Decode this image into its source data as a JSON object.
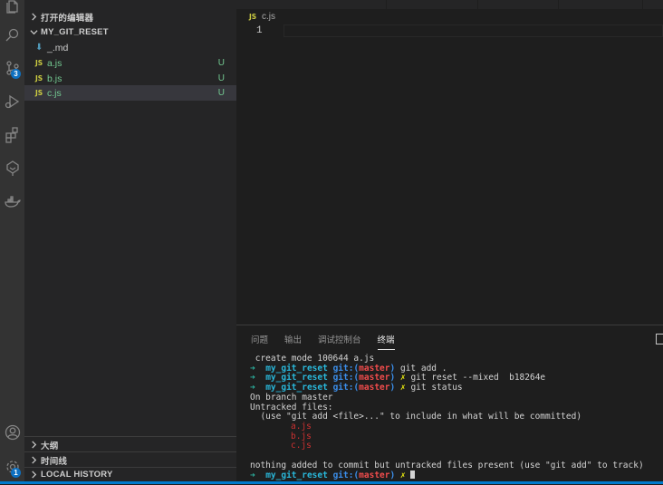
{
  "activity_bar": {
    "items": [
      {
        "icon": "files-icon"
      },
      {
        "icon": "search-icon"
      },
      {
        "icon": "source-control-icon",
        "badge": "3"
      },
      {
        "icon": "run-debug-icon"
      },
      {
        "icon": "extensions-icon"
      },
      {
        "icon": "tree-icon"
      },
      {
        "icon": "docker-icon"
      }
    ],
    "bottom": [
      {
        "icon": "account-icon"
      },
      {
        "icon": "settings-gear-icon",
        "badge": "1"
      }
    ]
  },
  "sidebar": {
    "open_editors_title": "打开的编辑器",
    "folder_title": "MY_GIT_RESET",
    "files": [
      {
        "name": "_.md",
        "icon": "markdown-icon",
        "status": ""
      },
      {
        "name": "a.js",
        "icon": "js-icon",
        "status": "U"
      },
      {
        "name": "b.js",
        "icon": "js-icon",
        "status": "U"
      },
      {
        "name": "c.js",
        "icon": "js-icon",
        "status": "U"
      }
    ],
    "outline_title": "大纲",
    "timeline_title": "时间线",
    "local_history_title": "LOCAL HISTORY"
  },
  "editor": {
    "breadcrumb_icon": "JS",
    "breadcrumb_file": "c.js",
    "line_number": "1"
  },
  "panel": {
    "tabs": [
      "问题",
      "输出",
      "调试控制台",
      "终端"
    ],
    "active_tab": "终端"
  },
  "terminal": {
    "create_line": " create mode 100644 a.js",
    "arrow": "➜",
    "dir": "my_git_reset",
    "git_label": "git:(",
    "branch": "master",
    "git_close": ")",
    "dirty": "✗",
    "cmd1": "git add .",
    "cmd2": "git reset --mixed  b18264e",
    "cmd3": "git status",
    "on_branch": "On branch master",
    "untracked_header": "Untracked files:",
    "untracked_hint": "  (use \"git add <file>...\" to include in what will be committed)",
    "untracked_files": [
      "a.js",
      "b.js",
      "c.js"
    ],
    "summary": "nothing added to commit but untracked files present (use \"git add\" to track)"
  },
  "colors": {
    "activity_bar": "#333333",
    "sidebar": "#252526",
    "editor": "#1e1e1e",
    "untracked_green": "#73c991",
    "js_yellow": "#cbcb41",
    "badge_blue": "#0e70c0",
    "status_bar": "#007acc"
  }
}
